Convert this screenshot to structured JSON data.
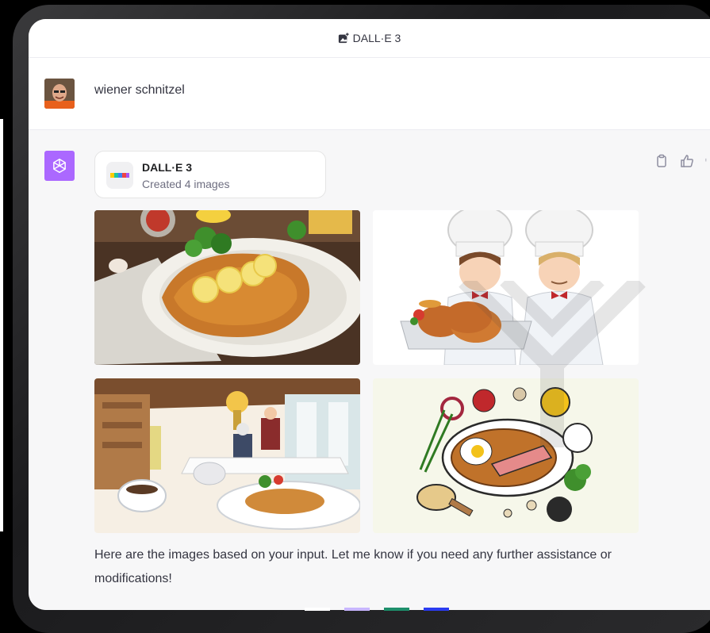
{
  "header": {
    "title": "DALL·E 3"
  },
  "user_message": {
    "text": "wiener schnitzel"
  },
  "assistant": {
    "tool_card": {
      "title": "DALL·E 3",
      "subtitle": "Created 4 images"
    },
    "images": [
      "schnitzel-plate",
      "two-chefs-cartoon",
      "restaurant-scene",
      "schnitzel-illustration"
    ],
    "reply": "Here are the images based on your input. Let me know if you need any further assistance or modifications!"
  },
  "colors": {
    "accent": "#ab68ff",
    "background": "#f7f7f8"
  }
}
